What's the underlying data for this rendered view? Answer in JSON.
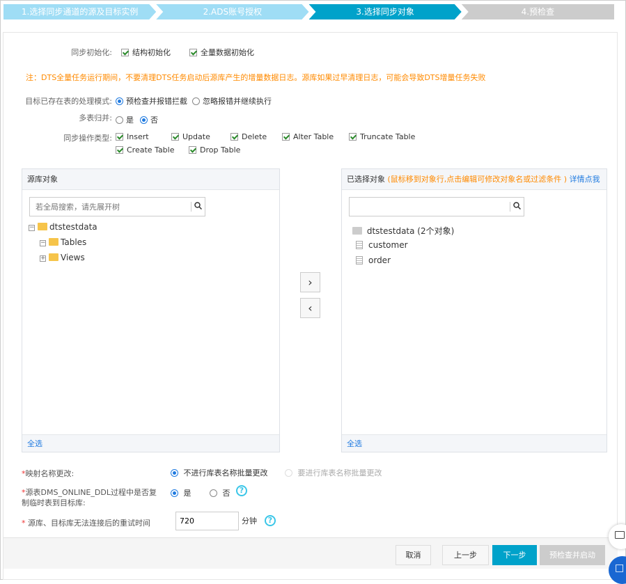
{
  "steps": [
    {
      "label": "1.选择同步通道的源及目标实例",
      "state": "done"
    },
    {
      "label": "2.ADS账号授权",
      "state": "done"
    },
    {
      "label": "3.选择同步对象",
      "state": "active"
    },
    {
      "label": "4.预检查",
      "state": "pending"
    }
  ],
  "colors": {
    "done": "#9fddf5",
    "active": "#00a2ca",
    "pending": "#cccccc",
    "warn": "#ff8a00",
    "link": "#1f7ae0"
  },
  "form": {
    "init_label": "同步初始化:",
    "init_struct": "结构初始化",
    "init_full": "全量数据初始化",
    "note": "注：DTS全量任务运行期间，不要清理DTS任务启动后源库产生的增量数据日志。源库如果过早清理日志，可能会导致DTS增量任务失败",
    "exist_label": "目标已存在表的处理模式:",
    "exist_opt1": "预检查并报错拦截",
    "exist_opt2": "忽略报错并继续执行",
    "merge_label": "多表归并:",
    "merge_yes": "是",
    "merge_no": "否",
    "ops_label": "同步操作类型:",
    "ops": [
      "Insert",
      "Update",
      "Delete",
      "Alter Table",
      "Truncate Table",
      "Create Table",
      "Drop Table"
    ]
  },
  "source": {
    "title": "源库对象",
    "search_placeholder": "若全局搜索，请先展开树",
    "tree": {
      "db": "dtstestdata",
      "tables": "Tables",
      "views": "Views"
    },
    "select_all": "全选"
  },
  "target": {
    "title": "已选择对象",
    "hint": "(鼠标移到对象行,点击编辑可修改对象名或过滤条件 )",
    "detail_link": "详情点我",
    "search_value": "",
    "db": "dtstestdata (2个对象)",
    "items": [
      "customer",
      "order"
    ],
    "select_all": "全选"
  },
  "options": {
    "rename_label": "映射名称更改:",
    "rename_opt1": "不进行库表名称批量更改",
    "rename_opt2": "要进行库表名称批量更改",
    "ddl_label": "源表DMS_ONLINE_DDL过程中是否复制临时表到目标库:",
    "ddl_yes": "是",
    "ddl_no": "否",
    "retry_label": "源库、目标库无法连接后的重试时间",
    "retry_value": "720",
    "retry_unit": "分钟"
  },
  "footer": {
    "cancel": "取消",
    "prev": "上一步",
    "next": "下一步",
    "precheck": "预检查并启动"
  }
}
